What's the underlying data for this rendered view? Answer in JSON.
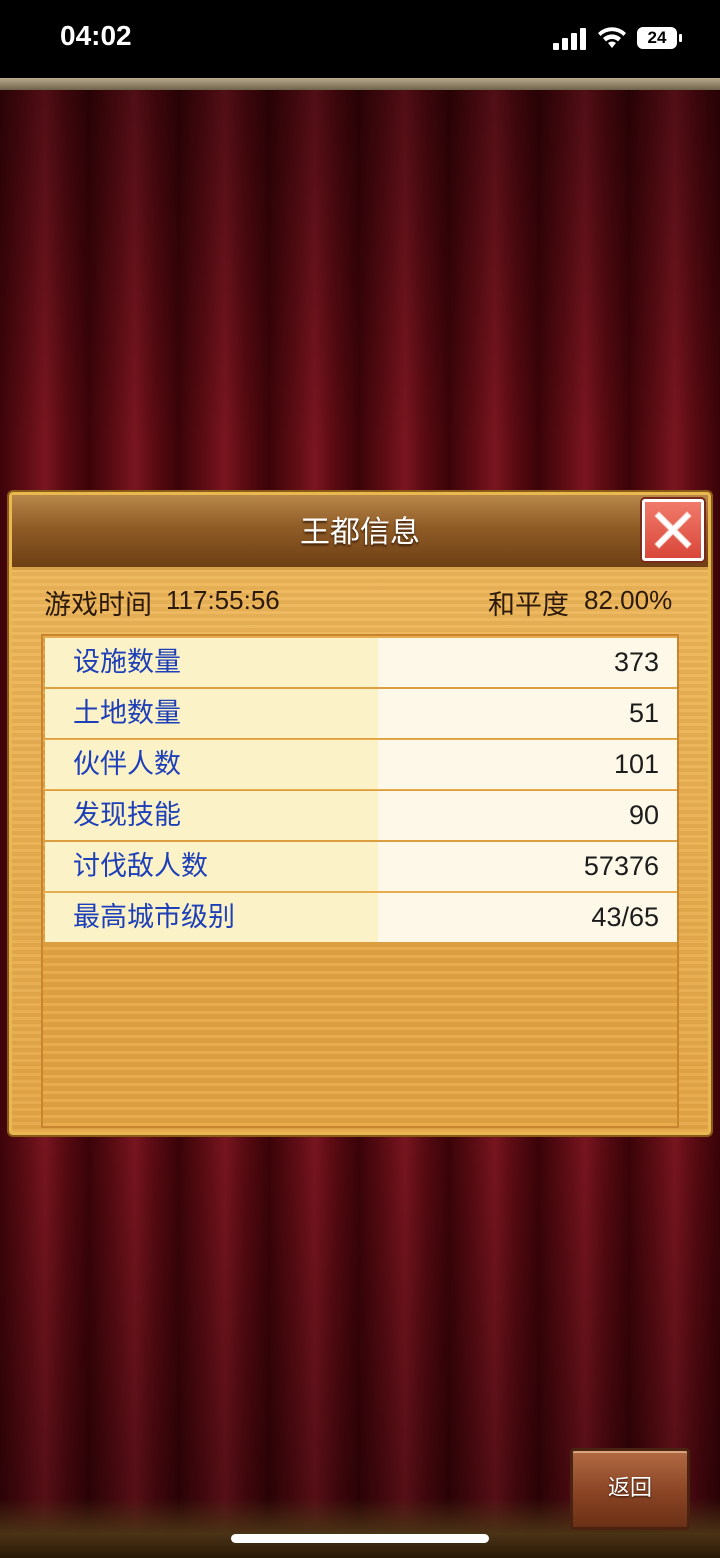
{
  "status_bar": {
    "time": "04:02",
    "battery": "24",
    "icons": [
      "signal-icon",
      "wifi-icon",
      "battery-icon"
    ]
  },
  "dialog": {
    "title": "王都信息",
    "close_icon": "close-icon",
    "playtime_label": "游戏时间",
    "playtime_value": "117:55:56",
    "peace_label": "和平度",
    "peace_value": "82.00%",
    "stats": [
      {
        "label": "设施数量",
        "value": "373"
      },
      {
        "label": "土地数量",
        "value": "51"
      },
      {
        "label": "伙伴人数",
        "value": "101"
      },
      {
        "label": "发现技能",
        "value": "90"
      },
      {
        "label": "讨伐敌人数",
        "value": "57376"
      },
      {
        "label": "最高城市级别",
        "value": "43/65"
      }
    ]
  },
  "back_button_label": "返回",
  "colors": {
    "label_blue": "#1d3fb8",
    "panel_gold": "#e6a746",
    "close_red": "#d9473a",
    "curtain_red": "#5e0c14"
  }
}
